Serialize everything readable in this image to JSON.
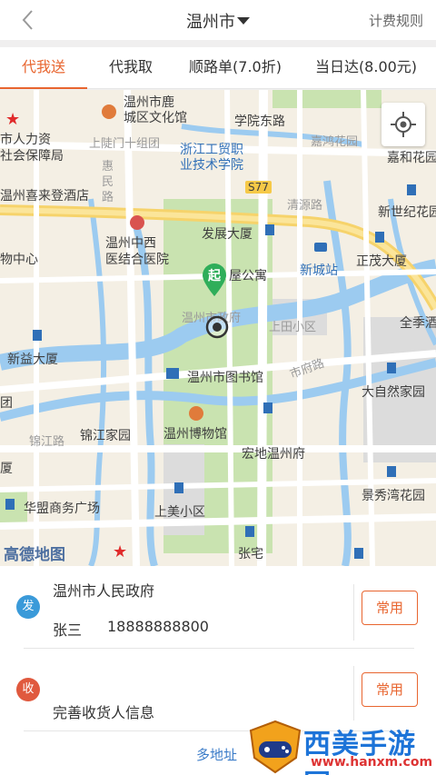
{
  "header": {
    "city": "温州市",
    "pricing_rules": "计费规则"
  },
  "tabs": [
    {
      "label": "代我送",
      "active": true
    },
    {
      "label": "代我取",
      "active": false
    },
    {
      "label": "顺路单(7.0折)",
      "active": false
    },
    {
      "label": "当日达(8.00元)",
      "active": false
    }
  ],
  "map": {
    "labels": {
      "lucheng_culture": "温州市鹿\n城区文化馆",
      "xueyuan_east": "学院东路",
      "jiahong": "嘉鸿花园",
      "jiahe": "嘉和花园",
      "shangtang_team": "上陡门十组团",
      "hr_social": "市人力资\n社会保障局",
      "zhejiang_college": "浙江工贸职\n业技术学院",
      "huimin_road": "惠\n民\n路",
      "s77": "S77",
      "xilai_hotel": "温州喜来登酒店",
      "qingyuan_road": "清源路",
      "xinshiji": "新世纪花园",
      "integrated_hospital": "温州中西\n医结合医院",
      "fazhan": "发展大厦",
      "xincheng_station": "新城站",
      "zhengmao": "正茂大厦",
      "shopping_center": "物中心",
      "apartment": "屋公寓",
      "government_gray": "温州市政府",
      "shangtian": "上田小区",
      "quanji": "全季酒",
      "xinyi": "新益大厦",
      "library": "温州市图书馆",
      "shifu_road": "市府路",
      "daziran": "大自然家园",
      "tuan": "团",
      "jinjiang_road": "锦江路",
      "jinjiang_home": "锦江家园",
      "museum": "温州博物馆",
      "hongdi": "宏地温州府",
      "xia": "厦",
      "jingxiuwan": "景秀湾花园",
      "huameng": "华盟商务广场",
      "shangmei": "上美小区",
      "zhangzhai": "张宅",
      "amap": "高德地图"
    },
    "start_pin_label": "起"
  },
  "sender": {
    "badge": "发",
    "address": "温州市人民政府",
    "name": "张三",
    "phone": "18888888800",
    "common_button": "常用"
  },
  "receiver": {
    "badge": "收",
    "placeholder": "完善收货人信息",
    "common_button": "常用"
  },
  "multi_address": "多地址",
  "watermark": {
    "text": "西美手游网",
    "url": "www.hanxm.com"
  },
  "colors": {
    "accent": "#e8652f",
    "send_badge": "#3a9ad9",
    "recv_badge": "#e0593e",
    "pin": "#2fae5a",
    "link": "#3a7bc8"
  }
}
